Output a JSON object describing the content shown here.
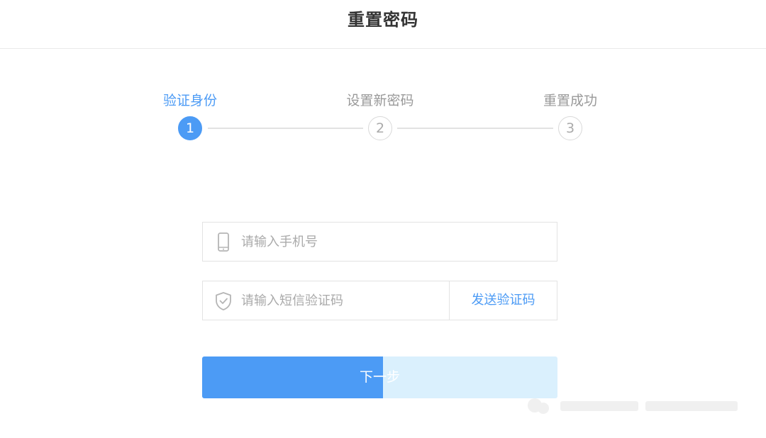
{
  "header": {
    "title": "重置密码"
  },
  "stepper": {
    "steps": [
      {
        "label": "验证身份",
        "number": "1",
        "active": true
      },
      {
        "label": "设置新密码",
        "number": "2",
        "active": false
      },
      {
        "label": "重置成功",
        "number": "3",
        "active": false
      }
    ]
  },
  "form": {
    "phone": {
      "placeholder": "请输入手机号",
      "value": "",
      "icon": "phone-icon"
    },
    "sms_code": {
      "placeholder": "请输入短信验证码",
      "value": "",
      "icon": "shield-check-icon",
      "send_code_label": "发送验证码"
    },
    "next_button_label": "下一步"
  },
  "colors": {
    "accent": "#4c9bf5",
    "accent_light": "#daf0fd",
    "inactive": "#999999",
    "border": "#e3e3e3"
  }
}
